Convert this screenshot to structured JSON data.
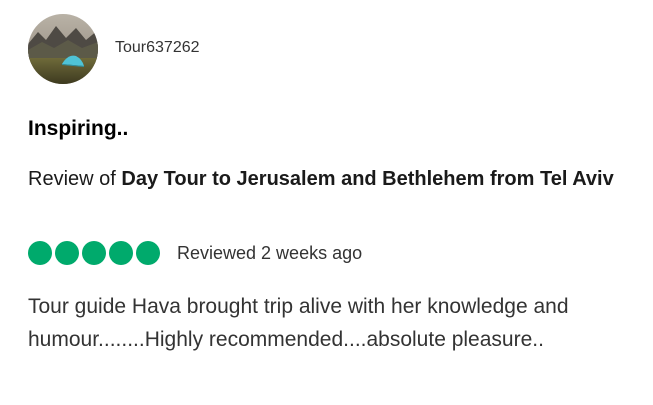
{
  "review": {
    "author": {
      "username": "Tour637262",
      "avatar_icon": "tent-landscape-avatar"
    },
    "title": "Inspiring..",
    "review_of_prefix": "Review of ",
    "product_name": "Day Tour to Jerusalem and Bethlehem from Tel Aviv",
    "rating": {
      "value": 5,
      "max": 5,
      "color": "#00aa6c"
    },
    "reviewed_date": "Reviewed 2 weeks ago",
    "body": "Tour guide Hava brought trip alive with her knowledge and humour........Highly recommended....absolute pleasure.."
  }
}
